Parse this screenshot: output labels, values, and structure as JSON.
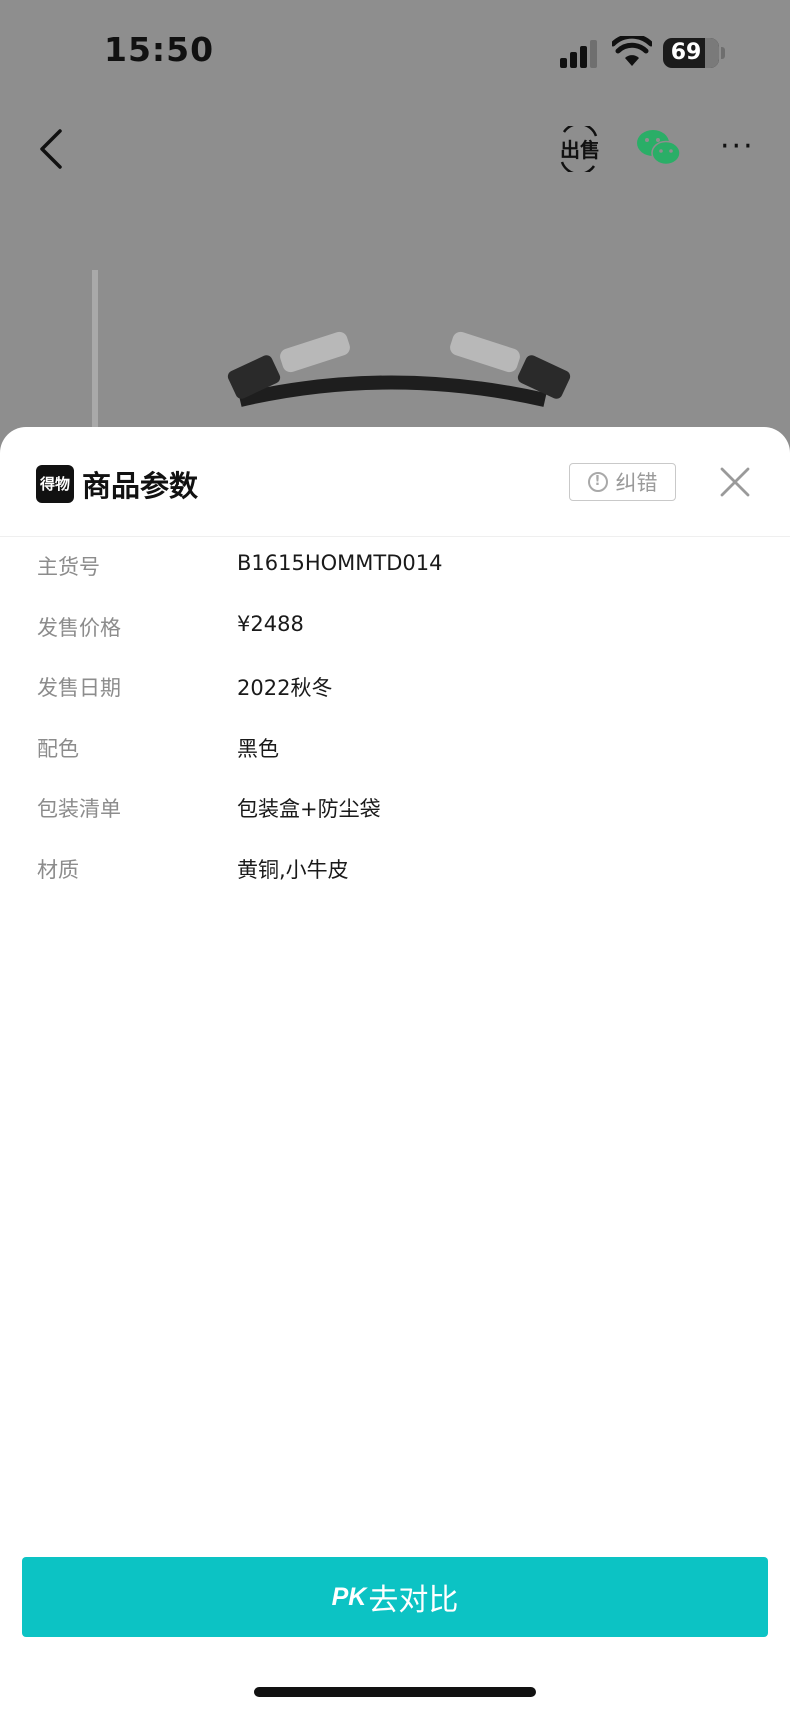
{
  "status_bar": {
    "time": "15:50",
    "battery": "69",
    "icons": [
      "signal-icon",
      "wifi-icon",
      "battery-icon"
    ]
  },
  "nav": {
    "icons": [
      "back-icon",
      "sell-icon",
      "wechat-icon",
      "more-icon"
    ],
    "sell_label": "出售",
    "more_label": "···"
  },
  "sheet": {
    "logo_text": "得物",
    "title": "商品参数",
    "report_label": "纠错",
    "close_icon": "close-icon",
    "params": [
      {
        "label": "主货号",
        "value": "B1615HOMMTD014"
      },
      {
        "label": "发售价格",
        "value": "¥2488"
      },
      {
        "label": "发售日期",
        "value": "2022秋冬"
      },
      {
        "label": "配色",
        "value": "黑色"
      },
      {
        "label": "包装清单",
        "value": "包装盒+防尘袋"
      },
      {
        "label": "材质",
        "value": "黄铜,小牛皮"
      }
    ],
    "pk_button": {
      "tag": "PK",
      "label": "去对比"
    }
  },
  "colors": {
    "accent": "#0cc3c4",
    "overlay": "#8e8e8e",
    "wechat_green": "#2aae67",
    "label_gray": "#8c8c8c"
  }
}
